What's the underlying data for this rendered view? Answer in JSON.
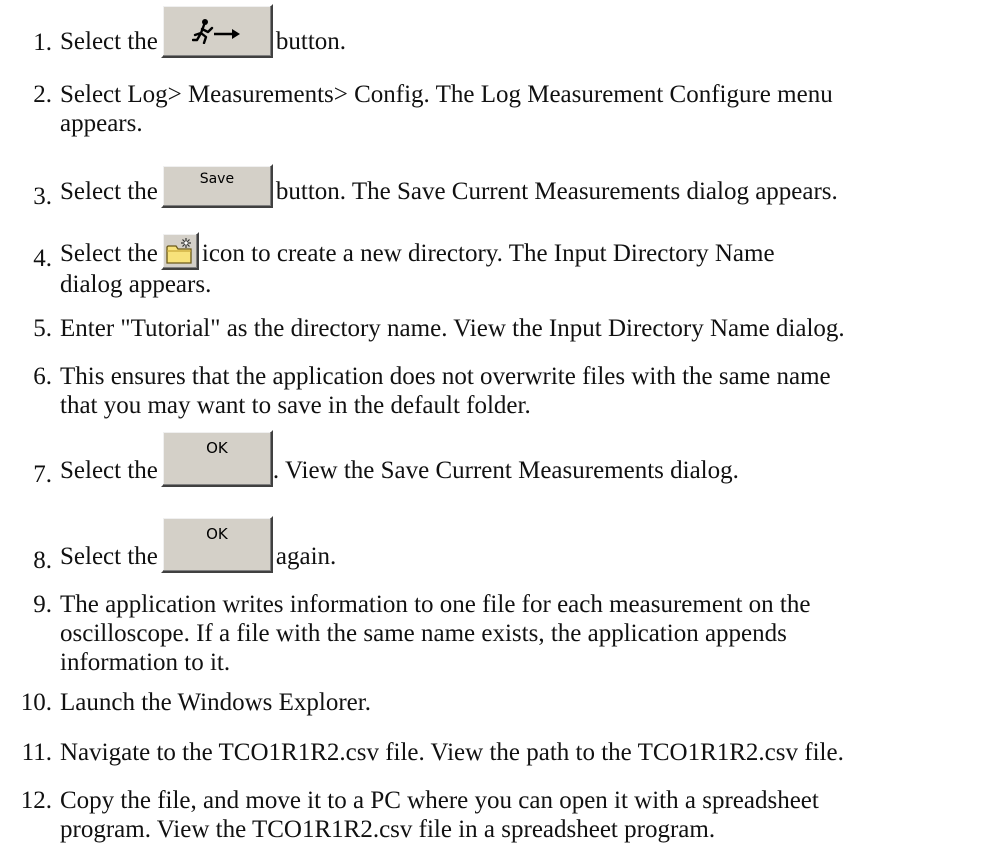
{
  "steps": [
    {
      "num": "1.",
      "before": "Select the",
      "after": "button.",
      "button": "run-icon"
    },
    {
      "num": "2.",
      "lines": [
        "Select Log> Measurements> Config. The Log Measurement Configure menu",
        "appears."
      ]
    },
    {
      "num": "3.",
      "before": "Select the",
      "button_label": "Save",
      "after": "button. The Save Current Measurements dialog appears."
    },
    {
      "num": "4.",
      "before": "Select the",
      "after": "icon to create a new directory. The Input Directory Name",
      "line2": "dialog appears.",
      "icon": "new-folder-icon"
    },
    {
      "num": "5.",
      "lines": [
        "Enter \"Tutorial\" as the directory name. View the Input Directory Name dialog."
      ]
    },
    {
      "num": "6.",
      "lines": [
        "This ensures that the application does not overwrite files with the same name",
        "that you may want to save in the default folder."
      ]
    },
    {
      "num": "7.",
      "before": "Select the",
      "button_label": "OK",
      "after": ". View the Save Current Measurements dialog."
    },
    {
      "num": "8.",
      "before": "Select the",
      "button_label": "OK",
      "after": "again."
    },
    {
      "num": "9.",
      "lines": [
        "The application writes information to one file for each measurement on the",
        "oscilloscope. If a file with the same name exists, the application appends",
        "information to it."
      ]
    },
    {
      "num": "10.",
      "lines": [
        "Launch the Windows Explorer."
      ]
    },
    {
      "num": "11.",
      "lines": [
        "Navigate to the TCO1R1R2.csv file. View the path to the TCO1R1R2.csv file."
      ]
    },
    {
      "num": "12.",
      "lines": [
        "Copy the file, and move it to a PC where you can open it with a spreadsheet",
        "program. View the TCO1R1R2.csv file in a spreadsheet program."
      ]
    }
  ],
  "colors": {
    "button_face": "#d4d0c8",
    "text": "#111111"
  }
}
